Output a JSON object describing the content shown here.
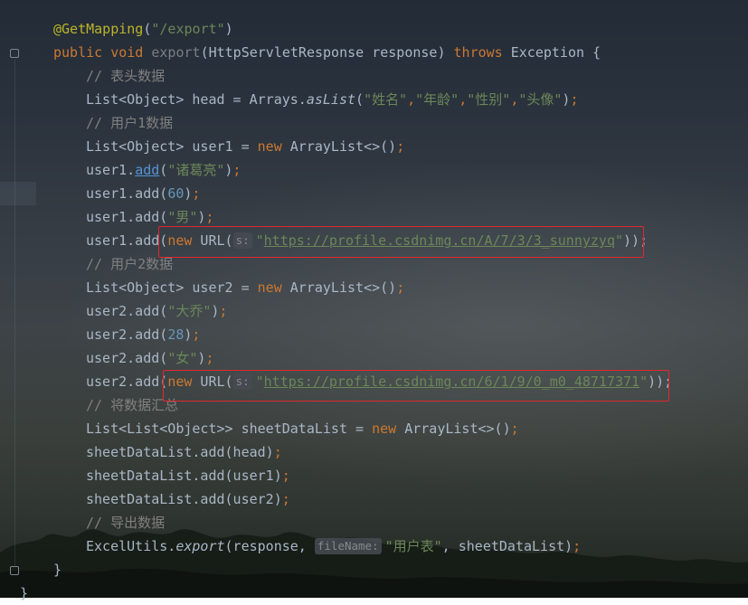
{
  "editor": {
    "lines": {
      "l1_annotation": "@GetMapping",
      "l1_path": "\"/export\"",
      "l2_public": "public",
      "l2_void": "void",
      "l2_method": "export",
      "l2_params": "(HttpServletResponse response)",
      "l2_throws": "throws",
      "l2_exc": "Exception {",
      "l3_comment": "// 表头数据",
      "l4_decl": "List<Object> head = Arrays.",
      "l4_aslist": "asList",
      "l4_s1": "\"姓名\"",
      "l4_s2": "\"年龄\"",
      "l4_s3": "\"性别\"",
      "l4_s4": "\"头像\"",
      "l5_comment": "// 用户1数据",
      "l6_decl": "List<Object> user1 = ",
      "l6_new": "new",
      "l6_rest": " ArrayList<>()",
      "l7_pre": "user1.",
      "l7_add": "add",
      "l7_str": "\"诸葛亮\"",
      "l8_pre": "user1.add(",
      "l8_num": "60",
      "l9_pre": "user1.add(",
      "l9_str": "\"男\"",
      "l10_pre": "user1.add(",
      "l10_new": "new",
      "l10_url": " URL(",
      "l10_hint": "s:",
      "l10_str_q1": "\"",
      "l10_link": "https://profile.csdnimg.cn/A/7/3/3_sunnyzyq",
      "l10_str_q2": "\"",
      "l10_end": "));",
      "l11_comment": "// 用户2数据",
      "l12_decl": "List<Object> user2 = ",
      "l12_new": "new",
      "l12_rest": " ArrayList<>()",
      "l13_pre": "user2.add(",
      "l13_str": "\"大乔\"",
      "l14_pre": "user2.add(",
      "l14_num": "28",
      "l15_pre": "user2.add(",
      "l15_str": "\"女\"",
      "l16_pre": "user2.add(",
      "l16_new": "new",
      "l16_url": " URL(",
      "l16_hint": "s:",
      "l16_str_q1": "\"",
      "l16_link": "https://profile.csdnimg.cn/6/1/9/0_m0_48717371",
      "l16_str_q2": "\"",
      "l16_end": "));",
      "l17_comment": "// 将数据汇总",
      "l18_decl": "List<List<Object>> sheetDataList = ",
      "l18_new": "new",
      "l18_rest": " ArrayList<>()",
      "l19": "sheetDataList.add(head)",
      "l20": "sheetDataList.add(user1)",
      "l21": "sheetDataList.add(user2)",
      "l22_comment": "// 导出数据",
      "l23_pre": "ExcelUtils.",
      "l23_export": "export",
      "l23_args1": "(response, ",
      "l23_hint": "fileName:",
      "l23_str": "\"用户表\"",
      "l23_args2": ", sheetDataList)",
      "l24": "}",
      "l25": "}"
    },
    "punct": {
      "open": "(",
      "close": ")",
      "semi": ";",
      "comma": ",",
      "close_semi": ");",
      "paren_semi": "();"
    }
  },
  "colors": {
    "keyword": "#cc7832",
    "annotation": "#bbb529",
    "string": "#6a8759",
    "number": "#6897bb",
    "comment": "#808080",
    "method": "#ffc66d",
    "highlight_box": "#e0282e"
  }
}
